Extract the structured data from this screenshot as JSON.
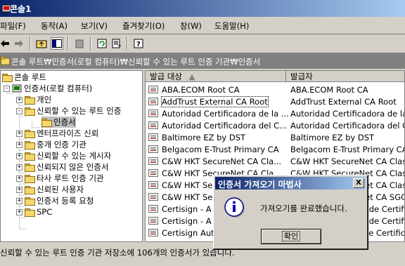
{
  "window": {
    "title": "콘솔1"
  },
  "menu": [
    "파일(F)",
    "동작(A)",
    "보기(V)",
    "즐겨찾기(O)",
    "창(W)",
    "도움말(H)"
  ],
  "toolbar": {
    "buttons": [
      "back-icon",
      "forward-icon",
      "up-folder-icon",
      "show-tree-icon",
      "delete-icon",
      "refresh-icon",
      "export-list-icon",
      "help-icon"
    ]
  },
  "address": {
    "path": "콘솔 루트₩인증서(로컬 컴퓨터)₩신뢰할 수 있는 루트 인증 기관₩인증서"
  },
  "tree": [
    {
      "label": "콘솔 루트",
      "level": 0,
      "expander": ""
    },
    {
      "label": "인증서(로컬 컴퓨터)",
      "level": 1,
      "expander": "-"
    },
    {
      "label": "개인",
      "level": 2,
      "expander": "+"
    },
    {
      "label": "신뢰할 수 있는 루트 인증",
      "level": 2,
      "expander": "-"
    },
    {
      "label": "인증서",
      "level": 3,
      "expander": ""
    },
    {
      "label": "엔터프라이즈 신뢰",
      "level": 2,
      "expander": "+"
    },
    {
      "label": "중개 인증 기관",
      "level": 2,
      "expander": "+"
    },
    {
      "label": "신뢰할 수 있는 게시자",
      "level": 2,
      "expander": "+"
    },
    {
      "label": "신뢰되지 않은 인증서",
      "level": 2,
      "expander": "+"
    },
    {
      "label": "타사 루트 인증 기관",
      "level": 2,
      "expander": "+"
    },
    {
      "label": "신뢰된 사용자",
      "level": 2,
      "expander": "+"
    },
    {
      "label": "인증서 등록 요청",
      "level": 2,
      "expander": "+"
    },
    {
      "label": "SPC",
      "level": 2,
      "expander": "+"
    }
  ],
  "list": {
    "columns": [
      "발급 대상",
      "발급자"
    ],
    "rows": [
      [
        "ABA.ECOM Root CA",
        "ABA.ECOM Root CA"
      ],
      [
        "AddTrust External CA Root",
        "AddTrust External CA Root"
      ],
      [
        "Autoridad Certificadora de la ...",
        "Autoridad Certificadora de la"
      ],
      [
        "Autoridad Certificadora del C...",
        "Autoridad Certificadora del C"
      ],
      [
        "Baltimore EZ by DST",
        "Baltimore EZ by DST"
      ],
      [
        "Belgacom E-Trust Primary CA",
        "Belgacom E-Trust Primary CA"
      ],
      [
        "C&W HKT SecureNet CA Cla...",
        "C&W HKT SecureNet CA Clas"
      ],
      [
        "C&W HKT SecureNet CA Cla...",
        "C&W HKT SecureNet CA Clas"
      ],
      [
        "C&W HKT Se",
        "C&W HKT SecureNet CA Clas"
      ],
      [
        "C&W HKT Se",
        "C&W HKT SecureNet CA SGC"
      ],
      [
        "Certisign - A",
        "Certisign - Autoridade Certific"
      ],
      [
        "Certisign - A",
        "Certisign - Autoridade Certific"
      ],
      [
        "Certisign Aut",
        "Certisign Autoridade Certifica"
      ]
    ],
    "selected_index": 1
  },
  "status": {
    "text": "신뢰할 수 있는 루트 인증 기관 저장소에 106개의 인증서가 있습니다."
  },
  "dialog": {
    "title": "인증서 가져오기 마법사",
    "message": "가져오기를 완료했습니다.",
    "ok": "확인",
    "close": "X"
  }
}
